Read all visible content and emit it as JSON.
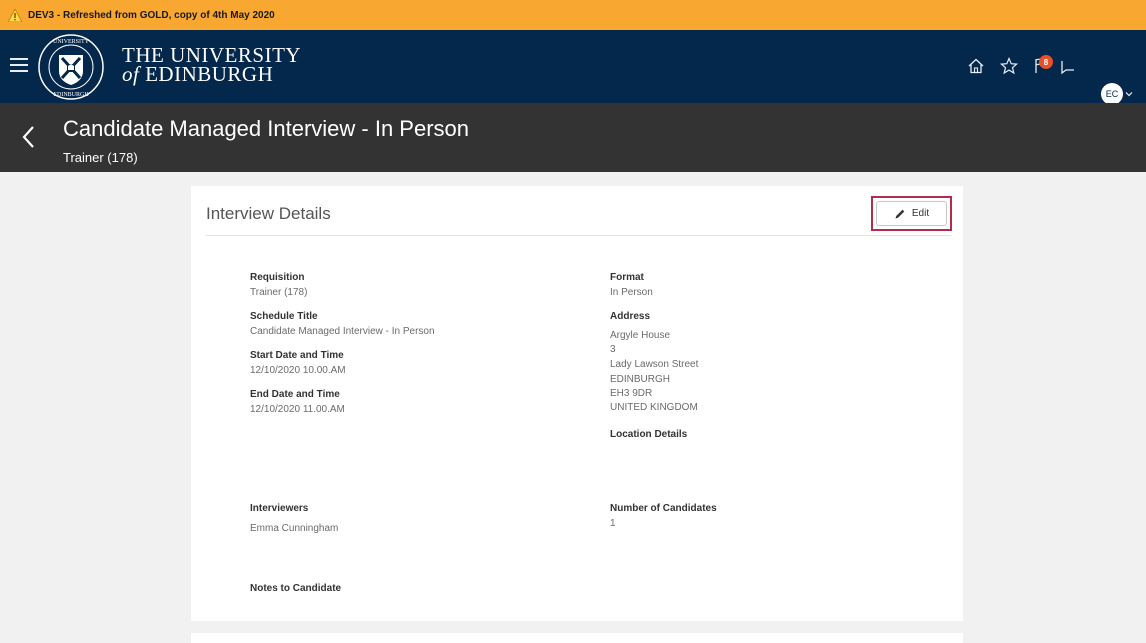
{
  "banner": {
    "text": "DEV3 - Refreshed from GOLD, copy of 4th May 2020"
  },
  "header": {
    "logo_line1": "THE UNIVERSITY",
    "logo_line2_of": "of",
    "logo_line2_rest": " EDINBURGH",
    "notification_count": "8",
    "avatar_initials": "EC"
  },
  "page": {
    "title": "Candidate Managed Interview - In Person",
    "subtitle": "Trainer (178)"
  },
  "card": {
    "title": "Interview Details",
    "edit_label": "Edit"
  },
  "fields": {
    "requisition_label": "Requisition",
    "requisition_value": "Trainer (178)",
    "schedule_label": "Schedule Title",
    "schedule_value": "Candidate Managed Interview - In Person",
    "start_label": "Start Date and Time",
    "start_value": "12/10/2020 10.00.AM",
    "end_label": "End Date and Time",
    "end_value": "12/10/2020 11.00.AM",
    "format_label": "Format",
    "format_value": "In Person",
    "address_label": "Address",
    "address_lines": [
      "Argyle House",
      "3",
      "Lady Lawson Street",
      "EDINBURGH",
      "EH3 9DR",
      "UNITED KINGDOM"
    ],
    "location_label": "Location Details",
    "interviewers_label": "Interviewers",
    "interviewers_value": "Emma Cunningham",
    "candidates_label": "Number of Candidates",
    "candidates_value": "1",
    "notes_label": "Notes to Candidate"
  },
  "colors": {
    "banner": "#f8a831",
    "header": "#04274c",
    "titlebar": "#333333",
    "edit_highlight": "#b12d4b",
    "badge": "#e6512a"
  }
}
